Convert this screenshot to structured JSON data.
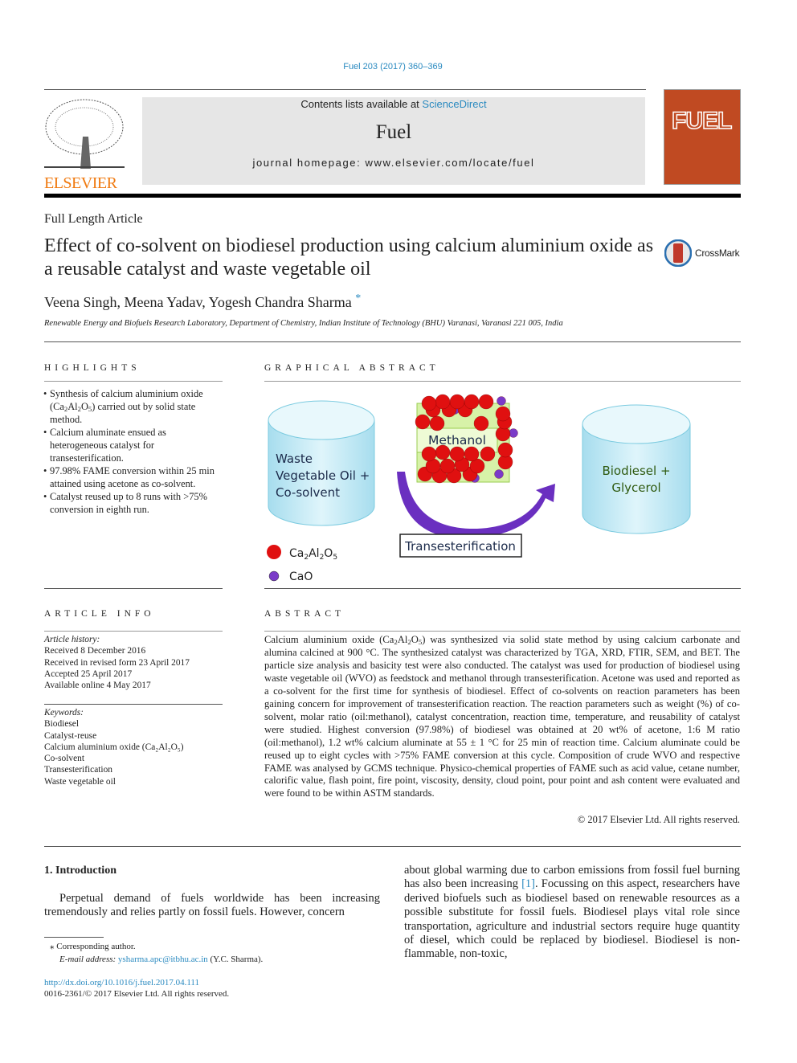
{
  "citation": "Fuel 203 (2017) 360–369",
  "header": {
    "contents_prefix": "Contents lists available at ",
    "contents_link": "ScienceDirect",
    "journal": "Fuel",
    "homepage": "journal homepage: www.elsevier.com/locate/fuel",
    "publisher": "ELSEVIER",
    "cover_title": "FUEL"
  },
  "article_type": "Full Length Article",
  "title": "Effect of co-solvent on biodiesel production using calcium aluminium oxide as a reusable catalyst and waste vegetable oil",
  "crossmark": "CrossMark",
  "authors": "Veena Singh, Meena Yadav, Yogesh Chandra Sharma",
  "author_mark": "*",
  "affiliation": "Renewable Energy and Biofuels Research Laboratory, Department of Chemistry, Indian Institute of Technology (BHU) Varanasi, Varanasi 221 005, India",
  "highlights": {
    "heading": "HIGHLIGHTS",
    "h1a": "Synthesis of calcium aluminium oxide (Ca",
    "h1b": "2",
    "h1c": "Al",
    "h1d": "2",
    "h1e": "O",
    "h1f": "5",
    "h1g": ") carried out by solid state method.",
    "h2": "Calcium aluminate ensued as heterogeneous catalyst for transesterification.",
    "h3": "97.98% FAME conversion within 25 min attained using acetone as co-solvent.",
    "h4": "Catalyst reused up to 8 runs with >75% conversion in eighth run."
  },
  "graphical_abstract": {
    "heading": "GRAPHICAL ABSTRACT",
    "left_l1": "Waste",
    "left_l2": "Vegetable Oil +",
    "left_l3": "Co-solvent",
    "methanol": "Methanol",
    "right_l1": "Biodiesel +",
    "right_l2": "Glycerol",
    "process": "Transesterification",
    "legend_red": "Ca2Al2O5",
    "legend_red_a": "Ca",
    "legend_red_b": "2",
    "legend_red_c": "Al",
    "legend_red_d": "2",
    "legend_red_e": "O",
    "legend_red_f": "5",
    "legend_purple": "CaO",
    "colors": {
      "red": "#e01010",
      "purple": "#7a3bc8",
      "cylinder": "#bfeaf5"
    }
  },
  "article_info": {
    "heading": "ARTICLE INFO",
    "history_label": "Article history:",
    "received": "Received 8 December 2016",
    "revised": "Received in revised form 23 April 2017",
    "accepted": "Accepted 25 April 2017",
    "online": "Available online 4 May 2017",
    "keywords_label": "Keywords:",
    "keywords": [
      "Biodiesel",
      "Catalyst-reuse",
      "Calcium aluminium oxide (Ca₂Al₂O₅)",
      "Co-solvent",
      "Transesterification",
      "Waste vegetable oil"
    ]
  },
  "abstract": {
    "heading": "ABSTRACT",
    "a1": "Calcium aluminium oxide (Ca",
    "s1": "2",
    "a2": "Al",
    "s2": "2",
    "a3": "O",
    "s3": "5",
    "a4": ") was synthesized via solid state method by using calcium carbonate and alumina calcined at 900 °C. The synthesized catalyst was characterized by TGA, XRD, FTIR, SEM, and BET. The particle size analysis and basicity test were also conducted. The catalyst was used for production of biodiesel using waste vegetable oil (WVO) as feedstock and methanol through transesterification. Acetone was used and reported as a co-solvent for the first time for synthesis of biodiesel. Effect of co-solvents on reaction parameters has been gaining concern for improvement of transesterification reaction. The reaction parameters such as weight (%) of co-solvent, molar ratio (oil:methanol), catalyst concentration, reaction time, temperature, and reusability of catalyst were studied. Highest conversion (97.98%) of biodiesel was obtained at 20 wt% of acetone, 1:6 M ratio (oil:methanol), 1.2 wt% calcium aluminate at 55 ± 1 °C for 25 min of reaction time. Calcium aluminate could be reused up to eight cycles with >75% FAME conversion at this cycle. Composition of crude WVO and respective FAME was analysed by GCMS technique. Physico-chemical properties of FAME such as acid value, cetane number, calorific value, flash point, fire point, viscosity, density, cloud point, pour point and ash content were evaluated and were found to be within ASTM standards.",
    "copyright": "© 2017 Elsevier Ltd. All rights reserved."
  },
  "intro": {
    "heading": "1. Introduction",
    "p1": "Perpetual demand of fuels worldwide has been increasing tremendously and relies partly on fossil fuels. However, concern",
    "col2a": "about global warming due to carbon emissions from fossil fuel burning has also been increasing ",
    "ref": "[1]",
    "col2b": ". Focussing on this aspect, researchers have derived biofuels such as biodiesel based on renewable resources as a possible substitute for fossil fuels. Biodiesel plays vital role since transportation, agriculture and industrial sectors require huge quantity of diesel, which could be replaced by biodiesel. Biodiesel is non-flammable, non-toxic,"
  },
  "footnote": {
    "mark": "⁎",
    "corresponding": "Corresponding author.",
    "email_label": "E-mail address: ",
    "email": "ysharma.apc@itbhu.ac.in",
    "email_suffix": " (Y.C. Sharma)."
  },
  "doi": "http://dx.doi.org/10.1016/j.fuel.2017.04.111",
  "issn": "0016-2361/© 2017 Elsevier Ltd. All rights reserved."
}
